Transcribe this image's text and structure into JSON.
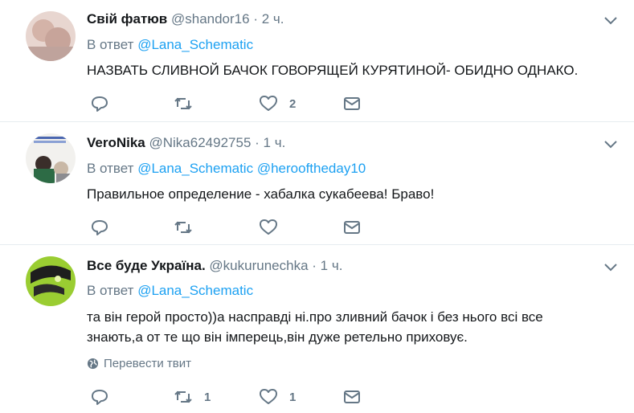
{
  "tweets": [
    {
      "name": "Свій фатюв",
      "handle": "@shandor16",
      "time": "2 ч.",
      "reply_prefix": "В ответ",
      "reply_to": [
        "@Lana_Schematic"
      ],
      "text_lines": [
        "НАЗВАТЬ СЛИВНОЙ БАЧОК ГОВОРЯЩЕЙ КУРЯТИНОЙ- ОБИДНО  ОДНАКО."
      ],
      "retweets": "",
      "likes": "2"
    },
    {
      "name": "VeroNika",
      "handle": "@Nika62492755",
      "time": "1 ч.",
      "reply_prefix": "В ответ",
      "reply_to": [
        "@Lana_Schematic",
        "@herooftheday10"
      ],
      "text_lines": [
        "Правильное определение - хабалка сукабеева! Браво!"
      ],
      "retweets": "",
      "likes": ""
    },
    {
      "name": "Все буде Україна.",
      "handle": "@kukurunechka",
      "time": "1 ч.",
      "reply_prefix": "В ответ",
      "reply_to": [
        "@Lana_Schematic"
      ],
      "text_lines": [
        "та він герой просто))а насправді ні.про зливний бачок і без нього всі все",
        "знають,а от те що він імперець,він дуже ретельно приховує."
      ],
      "translate_label": "Перевести твит",
      "retweets": "1",
      "likes": "1"
    }
  ],
  "separator": "·",
  "icons": {
    "reply": "reply-icon",
    "retweet": "retweet-icon",
    "like": "heart-icon",
    "dm": "envelope-icon",
    "more": "chevron-down-icon",
    "globe": "globe-icon"
  },
  "colors": {
    "text": "#14171a",
    "muted": "#657786",
    "link": "#1da1f2",
    "border": "#e6ecf0"
  }
}
